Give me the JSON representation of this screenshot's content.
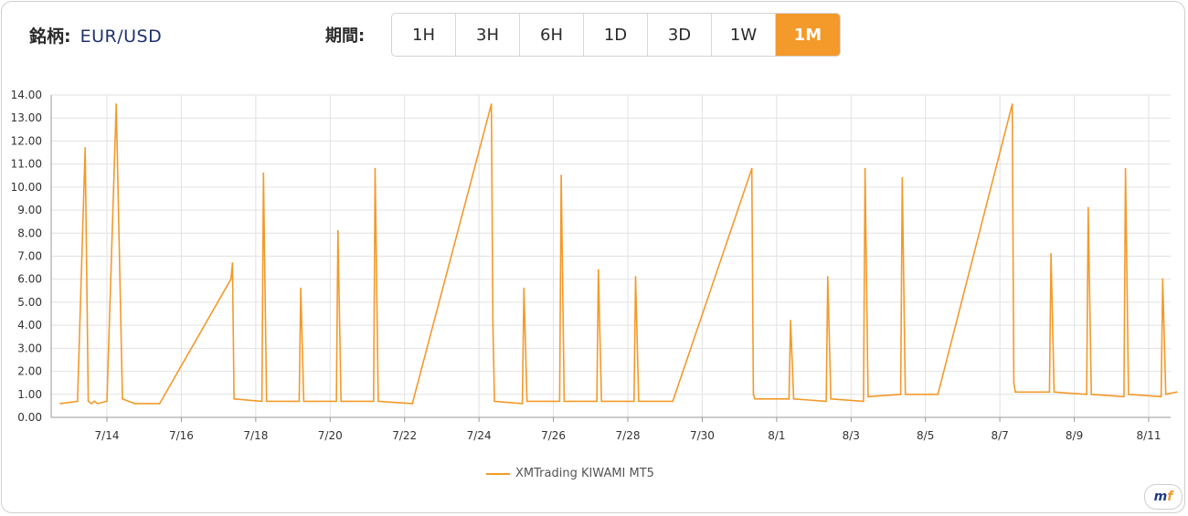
{
  "header": {
    "symbol_label": "銘柄:",
    "symbol_value": "EUR/USD",
    "period_label": "期間:",
    "periods": [
      "1H",
      "3H",
      "6H",
      "1D",
      "3D",
      "1W",
      "1M"
    ],
    "active_period": "1M"
  },
  "chart_data": {
    "type": "line",
    "title": "",
    "xlabel": "",
    "ylabel": "",
    "ylim": [
      0,
      14
    ],
    "y_ticks": [
      "0.00",
      "1.00",
      "2.00",
      "3.00",
      "4.00",
      "5.00",
      "6.00",
      "7.00",
      "8.00",
      "9.00",
      "10.00",
      "11.00",
      "12.00",
      "13.00",
      "14.00"
    ],
    "x_ticks": [
      "7/14",
      "7/16",
      "7/18",
      "7/20",
      "7/22",
      "7/24",
      "7/26",
      "7/28",
      "7/30",
      "8/1",
      "8/3",
      "8/5",
      "8/7",
      "8/9",
      "8/11"
    ],
    "grid": true,
    "legend_position": "bottom",
    "series": [
      {
        "name": "XMTrading KIWAMI MT5",
        "color": "#f39a2b",
        "x": [
          "7/12 18:00",
          "7/13 05:00",
          "7/13 10:00",
          "7/13 12:00",
          "7/13 14:00",
          "7/13 16:00",
          "7/13 18:00",
          "7/14 00:00",
          "7/14 06:00",
          "7/14 10:00",
          "7/14 14:00",
          "7/14 18:00",
          "7/15 02:00",
          "7/15 10:00",
          "7/17 08:00",
          "7/17 09:00",
          "7/17 10:00",
          "7/18 04:00",
          "7/18 05:00",
          "7/18 07:00",
          "7/19 04:00",
          "7/19 05:00",
          "7/19 07:00",
          "7/20 04:00",
          "7/20 05:00",
          "7/20 07:00",
          "7/21 04:00",
          "7/21 05:00",
          "7/21 07:00",
          "7/22 05:00",
          "7/24 08:00",
          "7/24 09:00",
          "7/24 10:00",
          "7/25 04:00",
          "7/25 05:00",
          "7/25 07:00",
          "7/26 04:00",
          "7/26 05:00",
          "7/26 07:00",
          "7/27 04:00",
          "7/27 05:00",
          "7/27 07:00",
          "7/28 04:00",
          "7/28 05:00",
          "7/28 07:00",
          "7/29 05:00",
          "7/31 08:00",
          "7/31 09:00",
          "7/31 10:00",
          "8/1 08:00",
          "8/1 09:00",
          "8/1 11:00",
          "8/2 08:00",
          "8/2 09:00",
          "8/2 11:00",
          "8/3 08:00",
          "8/3 09:00",
          "8/3 11:00",
          "8/4 08:00",
          "8/4 09:00",
          "8/4 11:00",
          "8/5 08:00",
          "8/7 08:00",
          "8/7 09:00",
          "8/7 10:00",
          "8/8 08:00",
          "8/8 09:00",
          "8/8 11:00",
          "8/9 08:00",
          "8/9 09:00",
          "8/9 11:00",
          "8/10 08:00",
          "8/10 09:00",
          "8/10 11:00",
          "8/11 08:00",
          "8/11 09:00",
          "8/11 11:00",
          "8/11 18:00"
        ],
        "values": [
          0.6,
          0.7,
          11.7,
          0.7,
          0.6,
          0.7,
          0.6,
          0.7,
          13.6,
          0.8,
          0.7,
          0.6,
          0.6,
          0.6,
          6.0,
          6.7,
          0.8,
          0.7,
          10.6,
          0.7,
          0.7,
          5.6,
          0.7,
          0.7,
          8.1,
          0.7,
          0.7,
          10.8,
          0.7,
          0.6,
          13.6,
          4.0,
          0.7,
          0.6,
          5.6,
          0.7,
          0.7,
          10.5,
          0.7,
          0.7,
          6.4,
          0.7,
          0.7,
          6.1,
          0.7,
          0.7,
          10.8,
          1.0,
          0.8,
          0.8,
          4.2,
          0.8,
          0.7,
          6.1,
          0.8,
          0.7,
          10.8,
          0.9,
          1.0,
          10.4,
          1.0,
          1.0,
          13.6,
          1.5,
          1.1,
          1.1,
          7.1,
          1.1,
          1.0,
          9.1,
          1.0,
          0.9,
          10.8,
          1.0,
          0.9,
          6.0,
          1.0,
          1.1
        ]
      }
    ]
  },
  "logo_text": "m",
  "logo_accent": "f"
}
